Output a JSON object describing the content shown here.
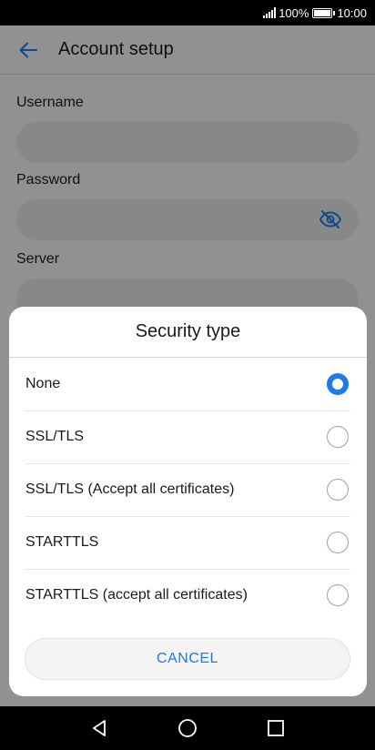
{
  "status_bar": {
    "battery_percent": "100%",
    "time": "10:00",
    "icons": [
      "signal-icon",
      "battery-icon"
    ]
  },
  "app_bar": {
    "title": "Account setup",
    "back_icon": "back-arrow-icon"
  },
  "form": {
    "username_label": "Username",
    "username_value": "",
    "password_label": "Password",
    "password_value": "",
    "password_toggle_icon": "eye-off-icon",
    "server_label": "Server",
    "server_value": ""
  },
  "dialog": {
    "title": "Security type",
    "options": [
      {
        "label": "None",
        "selected": true
      },
      {
        "label": "SSL/TLS",
        "selected": false
      },
      {
        "label": "SSL/TLS (Accept all certificates)",
        "selected": false
      },
      {
        "label": "STARTTLS",
        "selected": false
      },
      {
        "label": "STARTTLS (accept all certificates)",
        "selected": false
      }
    ],
    "cancel_label": "CANCEL"
  },
  "nav_bar": {
    "icons": [
      "back-triangle-icon",
      "home-circle-icon",
      "recents-square-icon"
    ]
  },
  "colors": {
    "accent": "#1e7ae6",
    "background": "#f2f2f2",
    "input_fill": "#e3e3e3"
  }
}
